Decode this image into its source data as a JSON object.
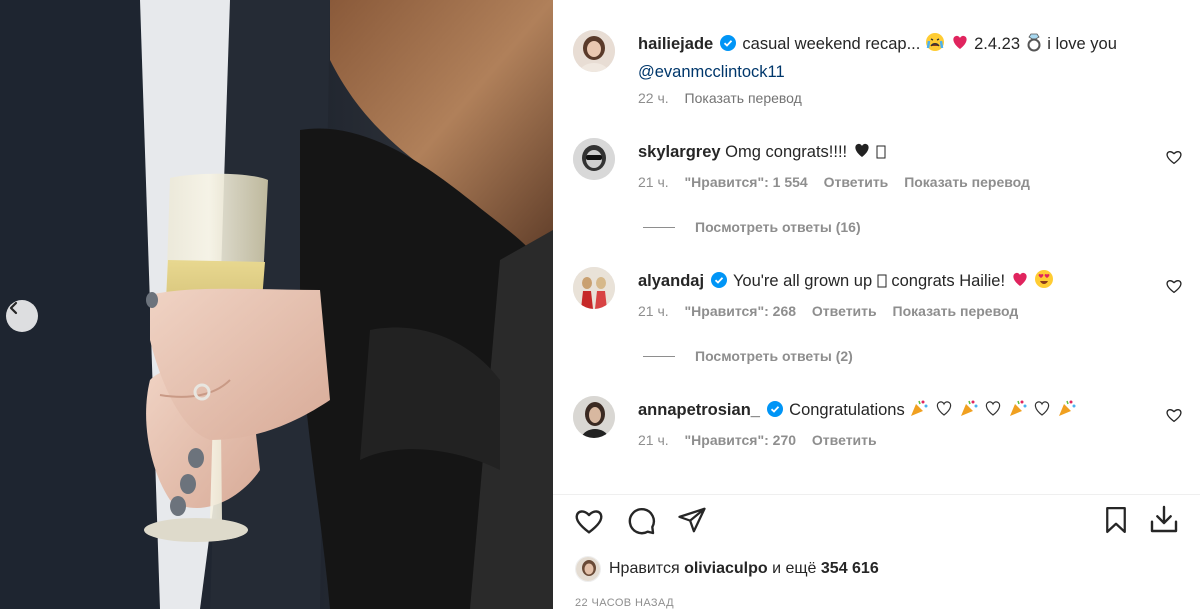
{
  "caption": {
    "username": "hailiejade",
    "text_before": "casual weekend recap...",
    "text_after": "2.4.23",
    "text_end": "i love you",
    "mention": "@evanmcclintock11",
    "time": "22 ч.",
    "translate": "Показать перевод"
  },
  "comments": [
    {
      "username": "skylargrey",
      "text": "Omg congrats!!!!",
      "tail": "🤍",
      "time": "21 ч.",
      "likes": "\"Нравится\": 1 554",
      "reply": "Ответить",
      "translate": "Показать перевод",
      "view_replies": "Посмотреть ответы (16)"
    },
    {
      "username": "alyandaj",
      "text": "You're all grown up",
      "text2": "congrats Hailie!",
      "time": "21 ч.",
      "likes": "\"Нравится\": 268",
      "reply": "Ответить",
      "translate": "Показать перевод",
      "view_replies": "Посмотреть ответы (2)"
    },
    {
      "username": "annapetrosian_",
      "text": "Congratulations",
      "time": "21 ч.",
      "likes": "\"Нравится\": 270",
      "reply": "Ответить"
    }
  ],
  "likes_line": {
    "prefix": "Нравится",
    "user": "oliviaculpo",
    "suffix": "и ещё",
    "count": "354 616"
  },
  "timestamp": "22 ЧАСОВ НАЗАД",
  "colors": {
    "verified": "#0095f6",
    "muted": "#8e8e8e",
    "mention": "#00376b"
  },
  "icons": [
    "heart-icon",
    "comment-icon",
    "share-icon",
    "bookmark-icon",
    "download-icon",
    "chevron-left-icon",
    "verified-icon"
  ]
}
